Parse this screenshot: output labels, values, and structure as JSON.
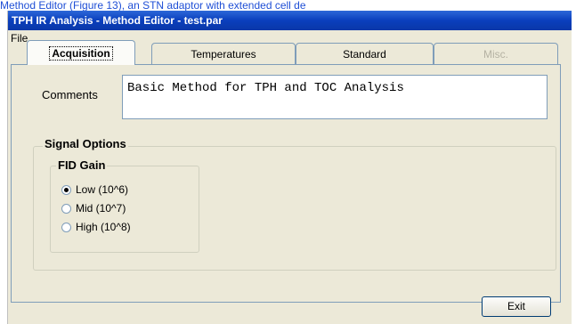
{
  "caption": {
    "text": "Method Editor (Figure 13), an STN adaptor with extended cell de"
  },
  "window": {
    "title": "TPH IR Analysis - Method Editor - test.par"
  },
  "menu": {
    "file_label": "File"
  },
  "tabs": [
    {
      "label": "Acquisition",
      "state": "active"
    },
    {
      "label": "Temperatures",
      "state": "normal"
    },
    {
      "label": "Standard",
      "state": "normal"
    },
    {
      "label": "Misc.",
      "state": "disabled"
    }
  ],
  "comments": {
    "label": "Comments",
    "value": "Basic Method for TPH and TOC Analysis"
  },
  "signal_options": {
    "title": "Signal Options",
    "fid_gain": {
      "title": "FID Gain",
      "options": [
        {
          "label": "Low (10^6)",
          "selected": true
        },
        {
          "label": "Mid (10^7)",
          "selected": false
        },
        {
          "label": "High (10^8)",
          "selected": false
        }
      ]
    }
  },
  "buttons": {
    "exit_label": "Exit"
  }
}
